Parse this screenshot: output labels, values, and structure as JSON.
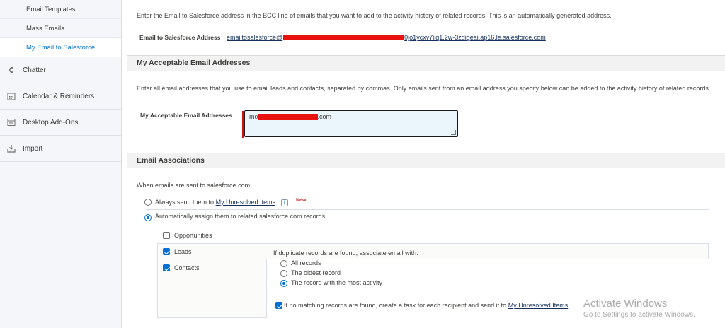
{
  "sidebar": {
    "sub_items": [
      {
        "label": "Email Templates"
      },
      {
        "label": "Mass Emails"
      },
      {
        "label": "My Email to Salesforce"
      }
    ],
    "items": [
      {
        "label": "Chatter",
        "icon": "chatter-icon"
      },
      {
        "label": "Calendar & Reminders",
        "icon": "calendar-icon"
      },
      {
        "label": "Desktop Add-Ons",
        "icon": "desktop-addons-icon"
      },
      {
        "label": "Import",
        "icon": "import-icon"
      }
    ]
  },
  "intro": {
    "text": "Enter the Email to Salesforce address in the BCC line of emails that you want to add to the activity history of related records. This is an automatically generated address."
  },
  "email_to_sf": {
    "label": "Email to Salesforce Address",
    "value_prefix": "emailtosalesforce@",
    "value_suffix": "0jo1ycxv7ilq1.2w-3zdigeai.ap16.le.salesforce.com"
  },
  "acceptable": {
    "header": "My Acceptable Email Addresses",
    "desc": "Enter all email addresses that you use to email leads and contacts, separated by commas. Only emails sent from an email address you specify below can be added to the activity history of related records.",
    "label": "My Acceptable Email Addresses",
    "value_prefix": "mo",
    "value_suffix": ".com"
  },
  "associations": {
    "header": "Email Associations",
    "when_text": "When emails are sent to salesforce.com:",
    "always_prefix": "Always send them to",
    "unresolved_link": "My Unresolved Items",
    "info_glyph": "i",
    "new_badge": "New!",
    "auto_label": "Automatically assign them to related salesforce.com records",
    "opportunities": "Opportunities",
    "leads": "Leads",
    "contacts": "Contacts",
    "duplicate_text": "If duplicate records are found, associate email with:",
    "opt_all": "All records",
    "opt_oldest": "The oldest record",
    "opt_most": "The record with the most activity",
    "no_match_prefix": "If no matching records are found, create a task for each recipient and send it to",
    "no_match_link": "My Unresolved Items"
  },
  "watermark": {
    "line1": "Activate Windows",
    "line2": "Go to Settings to activate Windows."
  },
  "colors": {
    "accent": "#0070d2",
    "redaction": "#e8130f",
    "sidebar_bg": "#f4f6f9"
  }
}
